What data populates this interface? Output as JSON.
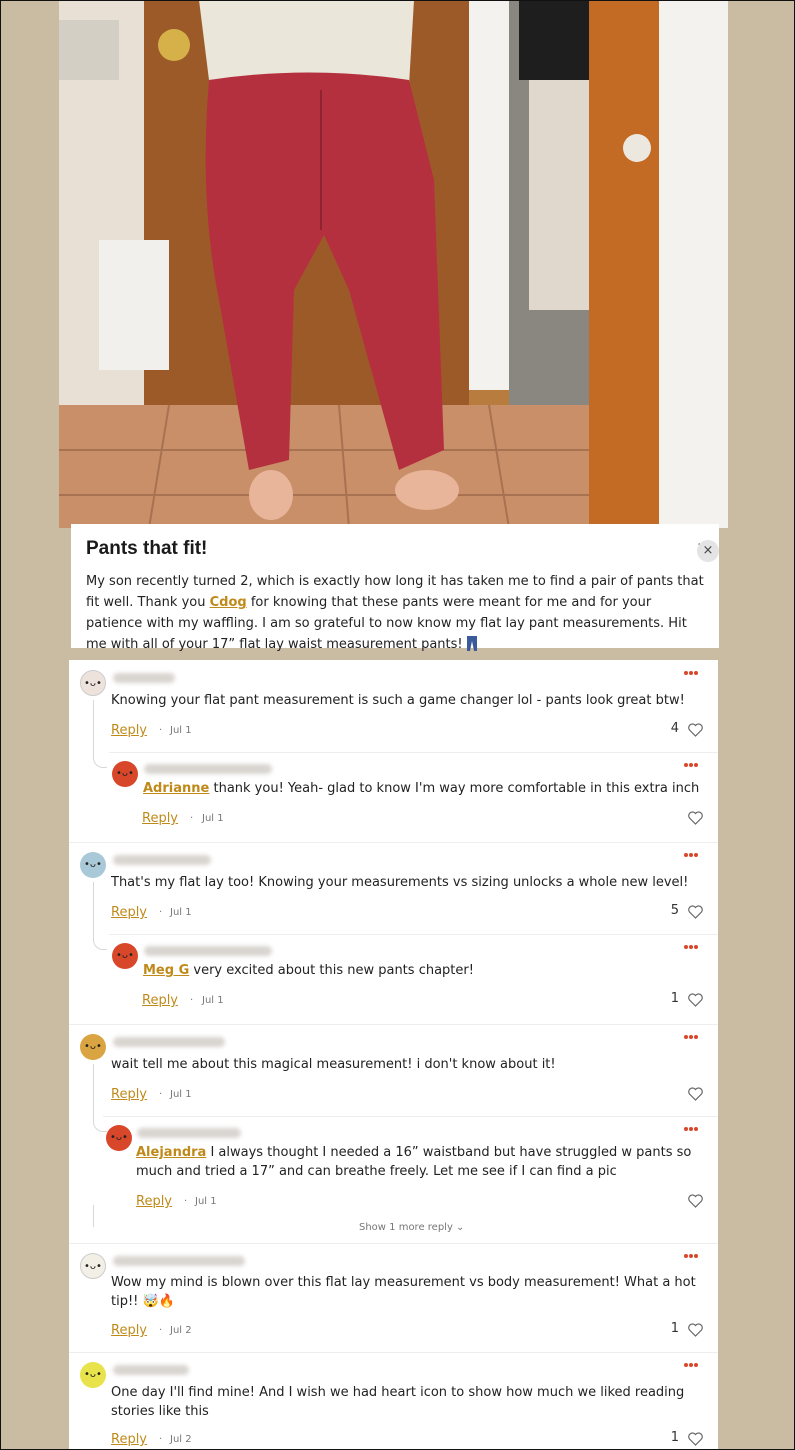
{
  "post": {
    "title": "Pants that fit!",
    "body_part1": "My son recently turned 2, which is exactly how long it has taken me to find a pair of pants that fit well. Thank you ",
    "mention": "Cdog",
    "body_part2": " for knowing that these pants were meant for me and for your patience with my waffling. I am so grateful to now know my flat lay pant measurements. Hit me with all of your 17” flat lay waist measurement pants!",
    "close_label": "×",
    "more_label": "..",
    "photo_icon": "jeans-icon"
  },
  "colors": {
    "accent": "#c08a1a",
    "more_dots": "#d9472b",
    "background": "#c9bca2",
    "pants": "#b5303f"
  },
  "comments": [
    {
      "text": "Knowing your flat pant measurement is such a game changer lol - pants look great btw!",
      "reply_label": "Reply",
      "date": "Jul 1",
      "likes": "4"
    },
    {
      "mention": "Adrianne",
      "text": " thank you! Yeah- glad to know I'm way more comfortable in this extra inch",
      "reply_label": "Reply",
      "date": "Jul 1",
      "likes": ""
    },
    {
      "text": "That's my flat lay too! Knowing your measurements vs sizing unlocks a whole new level!",
      "reply_label": "Reply",
      "date": "Jul 1",
      "likes": "5"
    },
    {
      "mention": "Meg G",
      "text": " very excited about this new pants chapter!",
      "reply_label": "Reply",
      "date": "Jul 1",
      "likes": "1"
    },
    {
      "text": "wait tell me about this magical measurement! i don't know about it!",
      "reply_label": "Reply",
      "date": "Jul 1",
      "likes": ""
    },
    {
      "mention": "Alejandra",
      "text": " I always thought I needed a 16” waistband but have struggled w pants so much and tried a 17” and can breathe freely. Let me see if I can find a pic",
      "reply_label": "Reply",
      "date": "Jul 1",
      "likes": ""
    },
    {
      "text": "Wow my mind is blown over this flat lay measurement vs body measurement! What a hot tip!! 🤯🔥",
      "reply_label": "Reply",
      "date": "Jul 2",
      "likes": "1"
    },
    {
      "text": "One day I'll find mine! And I wish we had heart icon to show how much we liked reading stories like this",
      "reply_label": "Reply",
      "date": "Jul 2",
      "likes": "1"
    }
  ],
  "show_more": "Show 1 more reply ⌄",
  "dot_separator": "·"
}
